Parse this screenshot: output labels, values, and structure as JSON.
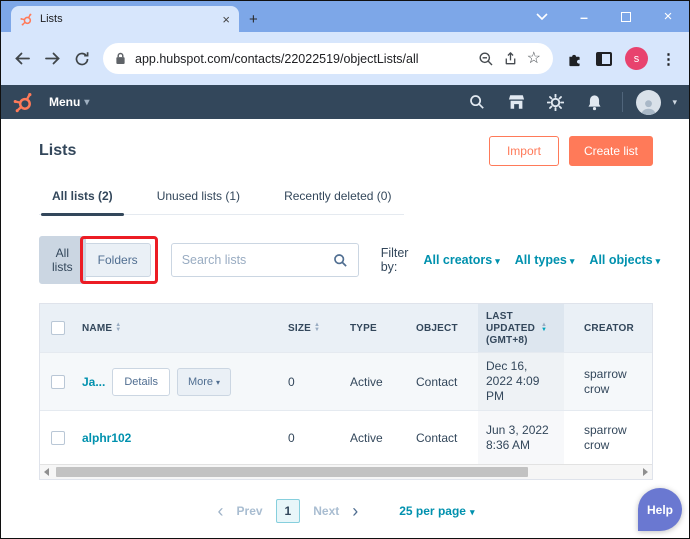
{
  "browser": {
    "tab_title": "Lists",
    "url": "app.hubspot.com/contacts/22022519/objectLists/all",
    "profile_initial": "s"
  },
  "nav": {
    "menu": "Menu"
  },
  "page": {
    "title": "Lists",
    "import": "Import",
    "create_list": "Create list",
    "tabs": [
      {
        "label": "All lists (2)"
      },
      {
        "label": "Unused lists (1)"
      },
      {
        "label": "Recently deleted (0)"
      }
    ],
    "toggle_all_lists": "All lists",
    "toggle_folders": "Folders",
    "search_placeholder": "Search lists",
    "filter_by": "Filter by:",
    "filters": [
      {
        "label": "All creators"
      },
      {
        "label": "All types"
      },
      {
        "label": "All objects"
      }
    ]
  },
  "table": {
    "col_name": "NAME",
    "col_size": "SIZE",
    "col_type": "TYPE",
    "col_object": "OBJECT",
    "col_last_updated": "LAST UPDATED",
    "col_last_updated_suffix": "(GMT+8)",
    "col_creator": "CREATOR",
    "rows": [
      {
        "name": "Ja...",
        "details": "Details",
        "more": "More",
        "size": "0",
        "type": "Active",
        "object": "Contact",
        "last_updated": "Dec 16, 2022 4:09 PM",
        "creator": "sparrow crow"
      },
      {
        "name": "alphr102",
        "size": "0",
        "type": "Active",
        "object": "Contact",
        "last_updated": "Jun 3, 2022 8:36 AM",
        "creator": "sparrow crow"
      }
    ]
  },
  "pagination": {
    "prev": "Prev",
    "page": "1",
    "next": "Next",
    "per_page": "25 per page"
  },
  "help": "Help",
  "icons": {
    "close": "×",
    "plus": "+",
    "minimize": "–",
    "dots": "⋮",
    "star": "☆",
    "caret_down": "▾",
    "sort_up": "▲",
    "sort_down": "▼",
    "chevron_left": "‹",
    "chevron_right": "›"
  },
  "colors": {
    "accent_orange": "#ff7a59",
    "nav_bg": "#33475b",
    "link_teal": "#0091ae",
    "annotation_red": "#ec1c24",
    "help_purple": "#6a78d1"
  }
}
